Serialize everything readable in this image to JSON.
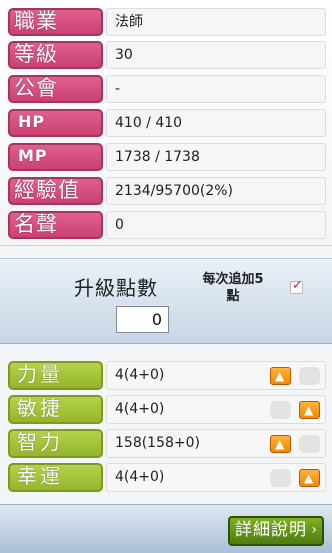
{
  "info": {
    "rows": [
      {
        "label": "職業",
        "value": "法師"
      },
      {
        "label": "等級",
        "value": "30"
      },
      {
        "label": "公會",
        "value": "-"
      },
      {
        "label": "HP",
        "value": "410 / 410"
      },
      {
        "label": "MP",
        "value": "1738 / 1738"
      },
      {
        "label": "經驗值",
        "value": "2134/95700(2%)"
      },
      {
        "label": "名聲",
        "value": "0"
      }
    ]
  },
  "ap": {
    "title": "升級點數",
    "points": "0",
    "auto_label_line1": "每次追加5",
    "auto_label_line2": "點",
    "auto_checked": true
  },
  "stats": [
    {
      "label": "力量",
      "value": "4(4+0)"
    },
    {
      "label": "敏捷",
      "value": "4(4+0)"
    },
    {
      "label": "智力",
      "value": "158(158+0)"
    },
    {
      "label": "幸運",
      "value": "4(4+0)"
    }
  ],
  "footer": {
    "detail_label": "詳細說明",
    "detail_chevron": "›"
  },
  "colors": {
    "info_label": "#d2507f",
    "stat_label": "#a4c33a",
    "up_button": "#f59a12",
    "detail_button": "#5e8f14"
  },
  "icons": {
    "up_arrow": "up-arrow-icon",
    "check": "check-icon"
  }
}
